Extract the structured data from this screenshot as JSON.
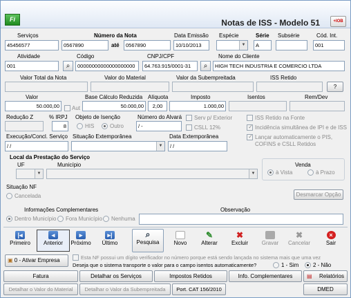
{
  "window": {
    "title": "Notas de ISS - Modelo 51",
    "logo": "Fi",
    "close_label": "+IOB"
  },
  "labels": {
    "servicos": "Serviços",
    "numero_nota": "Número da Nota",
    "ate": "até",
    "data_emissao": "Data Emissão",
    "especie": "Espécie",
    "serie": "Série",
    "subserie": "Subsérie",
    "cod_int": "Cód. Int.",
    "atividade": "Atividade",
    "codigo": "Código",
    "cnpj": "CNPJ/CPF",
    "nome_cliente": "Nome do Cliente",
    "valor_total": "Valor Total da Nota",
    "valor_material": "Valor do Material",
    "valor_subempreitada": "Valor da Subempreitada",
    "iss_retido": "ISS Retido",
    "valor": "Valor",
    "aut": "Aut",
    "base_calculo": "Base Cálculo Reduzida",
    "aliquota": "Alíquota",
    "imposto": "Imposto",
    "isentos": "Isentos",
    "rem_dev": "Rem/Dev",
    "reducao_z": "Redução Z",
    "pct_irpj": "% IRPJ",
    "objeto_isencao": "Objeto de Isenção",
    "his": "HIS",
    "outro": "Outro",
    "numero_alvara": "Número do Alvará",
    "serv_exterior": "Serv p/ Exterior",
    "csll": "CSLL 12%",
    "iss_retido_fonte": "ISS Retido na Fonte",
    "incidencia": "Incidência simultânea de IPI e de ISS",
    "lancar_auto": "Lançar automaticamente o PIS, COFINS e CSLL Retidos",
    "execucao": "Execução/Concl. Serviço",
    "situacao_extemporanea": "Situação Extemporânea",
    "data_extemporanea": "Data Extemporânea",
    "local_prestacao": "Local da Prestação do Serviço",
    "uf": "UF",
    "municipio": "Município",
    "venda": "Venda",
    "a_vista": "à Vista",
    "a_prazo": "à Prazo",
    "situacao_nf": "Situação NF",
    "cancelada": "Cancelada",
    "desmarcar": "Desmarcar Opção",
    "info_complementares": "Informações Complementares",
    "observacao": "Observação",
    "dentro_municipio": "Dentro Município",
    "fora_municipio": "Fora Município",
    "nenhuma": "Nenhuma",
    "digito_verificador": "Esta NF possui um dígito verificador no número porque está sendo lançada no sistema mais que uma vez",
    "pergunta_transporte": "Deseja que o sistema transporte o valor para o campo isentos automaticamente?",
    "sim": "1 - Sim",
    "nao": "2 - Não",
    "ativar_empresa": "0 - Ativar Empresa"
  },
  "values": {
    "servicos": "45456577",
    "numero_nota_de": "0567890",
    "numero_nota_ate": "0567890",
    "data_emissao": "10/10/2013",
    "especie": "",
    "serie": "A",
    "subserie": "",
    "cod_int": "001",
    "atividade": "001",
    "codigo": "00000000000000000000",
    "cnpj": "64.763.915/0001-31",
    "nome_cliente": "HIGH TECH INDUSTRIA E COMERCIO LTDA",
    "valor": "50.000,00",
    "base_calculo": "50.000,00",
    "aliquota": "2,00",
    "imposto": "1.000,00",
    "pct_irpj": "8",
    "numero_alvara": "/ -",
    "execucao": "/ /",
    "data_extemporanea": "/ /",
    "iss_retido_button": "?"
  },
  "nav": [
    {
      "label": "Primeiro",
      "icon": "first-icon"
    },
    {
      "label": "Anterior",
      "icon": "previous-icon"
    },
    {
      "label": "Próximo",
      "icon": "next-icon"
    },
    {
      "label": "Último",
      "icon": "last-icon"
    },
    {
      "label": "Pesquisa",
      "icon": "search-icon"
    },
    {
      "label": "Novo",
      "icon": "new-icon"
    },
    {
      "label": "Alterar",
      "icon": "edit-icon"
    },
    {
      "label": "Excluir",
      "icon": "delete-icon"
    },
    {
      "label": "Gravar",
      "icon": "save-icon"
    },
    {
      "label": "Cancelar",
      "icon": "cancel-icon"
    },
    {
      "label": "Sair",
      "icon": "exit-icon"
    }
  ],
  "bottom": {
    "fatura": "Fatura",
    "detalhar_servicos": "Detalhar os Serviços",
    "impostos_retidos": "Impostos Retidos",
    "info_complementares": "Info. Complementares",
    "relatorios": "Relatórios",
    "detalhar_material": "Detalhar o Valor do Material",
    "detalhar_subempreitada": "Detalhar o Valor da Subempreitada",
    "port_cat": "Port. CAT 156/2010",
    "dmed": "DMED"
  }
}
